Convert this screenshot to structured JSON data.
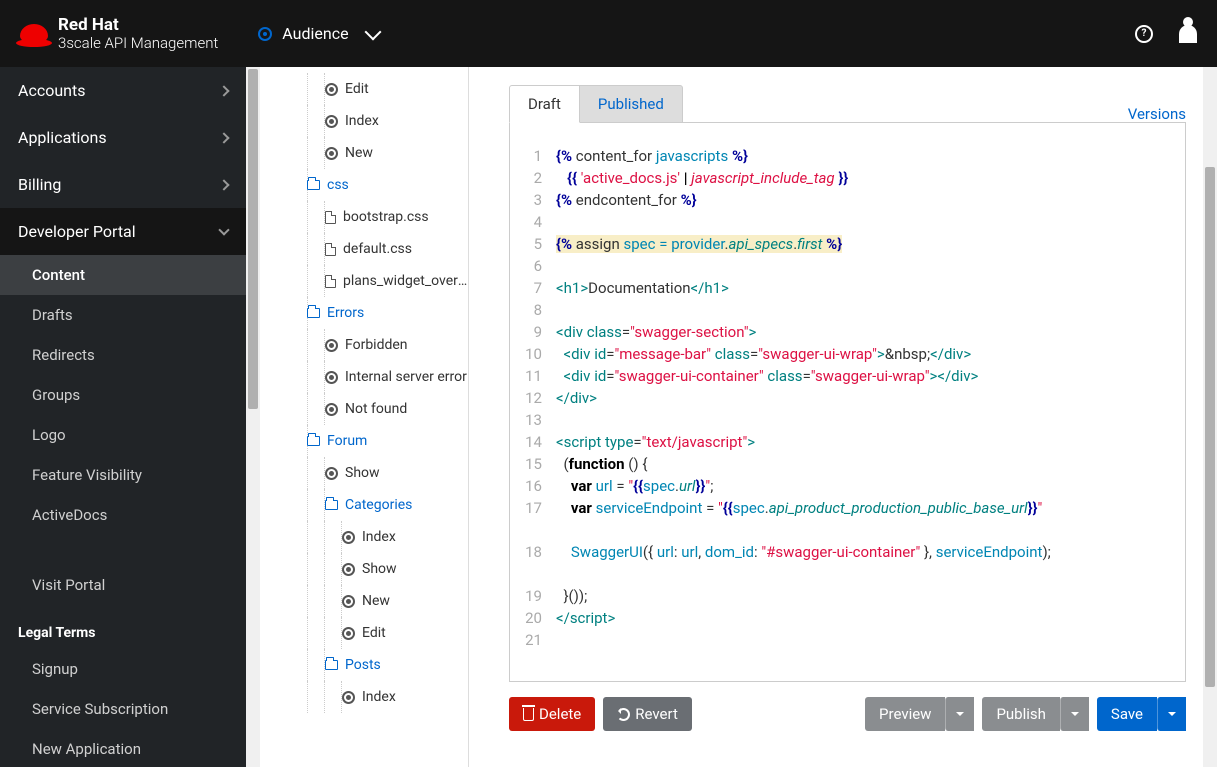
{
  "header": {
    "brand_top": "Red Hat",
    "brand_bottom": "3scale API Management",
    "context": "Audience"
  },
  "sidebar": {
    "primary": [
      {
        "label": "Accounts",
        "expandable": true
      },
      {
        "label": "Applications",
        "expandable": true
      },
      {
        "label": "Billing",
        "expandable": true
      },
      {
        "label": "Developer Portal",
        "expandable": true,
        "expanded": true
      }
    ],
    "dev_portal_sub": [
      {
        "label": "Content",
        "active": true
      },
      {
        "label": "Drafts"
      },
      {
        "label": "Redirects"
      },
      {
        "label": "Groups"
      },
      {
        "label": "Logo"
      },
      {
        "label": "Feature Visibility"
      },
      {
        "label": "ActiveDocs"
      }
    ],
    "visit_portal": "Visit Portal",
    "legal_heading": "Legal Terms",
    "legal_sub": [
      {
        "label": "Signup"
      },
      {
        "label": "Service Subscription"
      },
      {
        "label": "New Application"
      }
    ]
  },
  "tree": [
    {
      "depth": 2,
      "icon": "gear",
      "label": "Edit"
    },
    {
      "depth": 2,
      "icon": "gear",
      "label": "Index"
    },
    {
      "depth": 2,
      "icon": "gear",
      "label": "New"
    },
    {
      "depth": 1,
      "icon": "folder-open",
      "label": "css",
      "link": true
    },
    {
      "depth": 2,
      "icon": "file",
      "label": "bootstrap.css"
    },
    {
      "depth": 2,
      "icon": "file",
      "label": "default.css"
    },
    {
      "depth": 2,
      "icon": "file",
      "label": "plans_widget_overri..."
    },
    {
      "depth": 1,
      "icon": "folder-open",
      "label": "Errors",
      "link": true
    },
    {
      "depth": 2,
      "icon": "gear",
      "label": "Forbidden"
    },
    {
      "depth": 2,
      "icon": "gear",
      "label": "Internal server error"
    },
    {
      "depth": 2,
      "icon": "gear",
      "label": "Not found"
    },
    {
      "depth": 1,
      "icon": "folder-open",
      "label": "Forum",
      "link": true
    },
    {
      "depth": 2,
      "icon": "gear",
      "label": "Show"
    },
    {
      "depth": 2,
      "icon": "folder-open",
      "label": "Categories",
      "link": true
    },
    {
      "depth": 3,
      "icon": "gear",
      "label": "Index"
    },
    {
      "depth": 3,
      "icon": "gear",
      "label": "Show"
    },
    {
      "depth": 3,
      "icon": "gear",
      "label": "New"
    },
    {
      "depth": 3,
      "icon": "gear",
      "label": "Edit"
    },
    {
      "depth": 2,
      "icon": "folder-open",
      "label": "Posts",
      "link": true
    },
    {
      "depth": 3,
      "icon": "gear",
      "label": "Index"
    }
  ],
  "editor": {
    "tabs": [
      {
        "label": "Draft",
        "active": true
      },
      {
        "label": "Published"
      }
    ],
    "versions_link": "Versions",
    "line_count": 21,
    "code_lines": [
      {
        "n": 1,
        "html": "<span class='c-del'>{%</span> content_for <span class='c-var'>javascripts</span> <span class='c-del'>%}</span>"
      },
      {
        "n": 2,
        "html": "   <span class='c-del'>{{</span> <span class='c-str'>'active_docs.js'</span> <span class='c-pipe'>|</span> <span class='c-func'>javascript_include_tag</span> <span class='c-del'>}}</span>"
      },
      {
        "n": 3,
        "html": "<span class='c-del'>{%</span> endcontent_for <span class='c-del'>%}</span>"
      },
      {
        "n": 4,
        "html": ""
      },
      {
        "n": 5,
        "html": "<span class='hl'><span class='c-del'>{%</span> assign <span class='c-var'>spec</span> <span class='c-var'>=</span> <span class='c-var'>provider</span>.<span class='c-id'>api_specs</span>.<span class='c-id'>first</span> <span class='c-del'>%}</span></span>"
      },
      {
        "n": 6,
        "html": ""
      },
      {
        "n": 7,
        "html": "<span class='c-tag'>&lt;h1&gt;</span>Documentation<span class='c-tag'>&lt;/h1&gt;</span>"
      },
      {
        "n": 8,
        "html": ""
      },
      {
        "n": 9,
        "html": "<span class='c-tag'>&lt;div</span> <span class='c-attr'>class</span>=<span class='c-str'>\"swagger-section\"</span><span class='c-tag'>&gt;</span>"
      },
      {
        "n": 10,
        "html": "  <span class='c-tag'>&lt;div</span> <span class='c-attr'>id</span>=<span class='c-str'>\"message-bar\"</span> <span class='c-attr'>class</span>=<span class='c-str'>\"swagger-ui-wrap\"</span><span class='c-tag'>&gt;</span>&amp;nbsp;<span class='c-tag'>&lt;/div&gt;</span>"
      },
      {
        "n": 11,
        "html": "  <span class='c-tag'>&lt;div</span> <span class='c-attr'>id</span>=<span class='c-str'>\"swagger-ui-container\"</span> <span class='c-attr'>class</span>=<span class='c-str'>\"swagger-ui-wrap\"</span><span class='c-tag'>&gt;&lt;/div&gt;</span>"
      },
      {
        "n": 12,
        "html": "<span class='c-tag'>&lt;/div&gt;</span>"
      },
      {
        "n": 13,
        "html": ""
      },
      {
        "n": 14,
        "html": "<span class='c-tag'>&lt;script</span> <span class='c-attr'>type</span>=<span class='c-str'>\"text/javascript\"</span><span class='c-tag'>&gt;</span>"
      },
      {
        "n": 15,
        "html": "  (<span class='c-kw'>function</span> () {"
      },
      {
        "n": 16,
        "html": "    <span class='c-kw'>var</span> <span class='c-var'>url</span> = <span class='c-str'>\"</span><span class='c-del'>{{</span><span class='c-var'>spec</span>.<span class='c-id'>url</span><span class='c-del'>}}</span><span class='c-str'>\"</span>;"
      },
      {
        "n": 17,
        "html": "    <span class='c-kw'>var</span> <span class='c-var'>serviceEndpoint</span> = <span class='c-str'>\"</span><span class='c-del'>{{</span><span class='c-var'>spec</span>.<span class='c-id'>api_product_production_public_base_url</span><span class='c-del'>}}</span><span class='c-str'>\"</span>",
        "wrap": true
      },
      {
        "n": 18,
        "html": "    <span class='c-var'>SwaggerUI</span>({ <span class='c-var'>url</span>: <span class='c-var'>url</span>, <span class='c-var'>dom_id</span>: <span class='c-str'>\"#swagger-ui-container\"</span> }, <span class='c-var'>serviceEndpoint</span>);",
        "wrap": true
      },
      {
        "n": 19,
        "html": "  }());"
      },
      {
        "n": 20,
        "html": "<span class='c-tag'>&lt;/script&gt;</span>"
      },
      {
        "n": 21,
        "html": ""
      }
    ]
  },
  "buttons": {
    "delete": "Delete",
    "revert": "Revert",
    "preview": "Preview",
    "publish": "Publish",
    "save": "Save"
  }
}
